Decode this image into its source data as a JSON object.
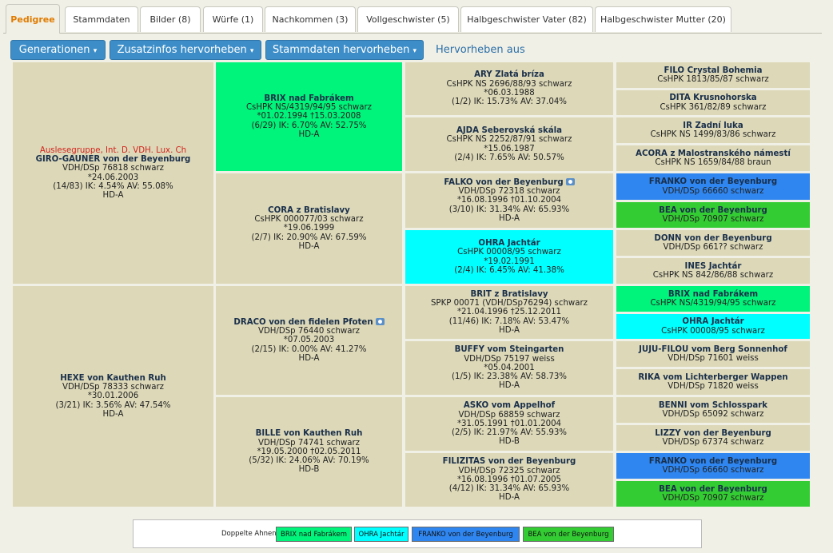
{
  "tabs": [
    "Pedigree",
    "Stammdaten",
    "Bilder (8)",
    "Würfe (1)",
    "Nachkommen (3)",
    "Vollgeschwister (5)",
    "Halbgeschwister Vater (82)",
    "Halbgeschwister Mutter (20)"
  ],
  "toolbar": {
    "generations": "Generationen",
    "extra": "Zusatzinfos hervorheben",
    "master": "Stammdaten hervorheben",
    "off": "Hervorheben aus",
    "caret": "▾"
  },
  "colors": {
    "cell": "#dcd8b8",
    "brix": "#00f37a",
    "ohra": "#00ffff",
    "franko": "#2f86f0",
    "bea": "#33cc33"
  },
  "pedigree": {
    "g1": [
      {
        "extra": "Auslesegruppe, Int. D. VDH. Lux. Ch",
        "name": "GIRO-GAUNER von der Beyenburg",
        "lines": [
          "VDH/DSp 76818 schwarz",
          "*24.06.2003",
          "(14/83) IK: 4.54% AV: 55.08%",
          "HD-A"
        ]
      },
      {
        "name": "HEXE von Kauthen Ruh",
        "lines": [
          "VDH/DSp 78333 schwarz",
          "*30.01.2006",
          "(3/21) IK: 3.56% AV: 47.54%",
          "HD-A"
        ]
      }
    ],
    "g2": [
      {
        "name": "BRIX nad Fabrákem",
        "lines": [
          "CsHPK NS/4319/94/95 schwarz",
          "*01.02.1994 †15.03.2008",
          "(6/29) IK: 6.70% AV: 52.75%",
          "HD-A"
        ]
      },
      {
        "name": "CORA z Bratislavy",
        "lines": [
          "CsHPK 000077/03 schwarz",
          "*19.06.1999",
          "(2/7) IK: 20.90% AV: 67.59%",
          "HD-A"
        ]
      },
      {
        "name": "DRACO von den fidelen Pfoten",
        "lines": [
          "VDH/DSp 76440 schwarz",
          "*07.05.2003",
          "(2/15) IK: 0.00% AV: 41.27%",
          "HD-A"
        ]
      },
      {
        "name": "BILLE von Kauthen Ruh",
        "lines": [
          "VDH/DSp 74741 schwarz",
          "*19.05.2000 †02.05.2011",
          "(5/32) IK: 24.06% AV: 70.19%",
          "HD-B"
        ]
      }
    ],
    "g3": [
      {
        "name": "ARY Zlatá bríza",
        "lines": [
          "CsHPK NS 2696/88/93 schwarz",
          "*06.03.1988",
          "(1/2) IK: 15.73% AV: 37.04%"
        ]
      },
      {
        "name": "AJDA Seberovská skála",
        "lines": [
          "CsHPK NS 2252/87/91 schwarz",
          "*15.06.1987",
          "(2/4) IK: 7.65% AV: 50.57%"
        ]
      },
      {
        "name": "FALKO von der Beyenburg",
        "lines": [
          "VDH/DSp 72318 schwarz",
          "*16.08.1996 †01.10.2004",
          "(3/10) IK: 31.34% AV: 65.93%",
          "HD-A"
        ]
      },
      {
        "name": "OHRA Jachtár",
        "lines": [
          "CsHPK 00008/95 schwarz",
          "*19.02.1991",
          "(2/4) IK: 6.45% AV: 41.38%"
        ]
      },
      {
        "name": "BRIT z Bratislavy",
        "lines": [
          "SPKP 00071 (VDH/DSp76294) schwarz",
          "*21.04.1996 †25.12.2011",
          "(11/46) IK: 7.18% AV: 53.47%",
          "HD-A"
        ]
      },
      {
        "name": "BUFFY vom Steingarten",
        "lines": [
          "VDH/DSp 75197 weiss",
          "*05.04.2001",
          "(1/5) IK: 23.38% AV: 58.73%",
          "HD-A"
        ]
      },
      {
        "name": "ASKO vom Appelhof",
        "lines": [
          "VDH/DSp 68859 schwarz",
          "*31.05.1991 †01.01.2004",
          "(2/5) IK: 21.97% AV: 55.93%",
          "HD-B"
        ]
      },
      {
        "name": "FILIZITAS von der Beyenburg",
        "lines": [
          "VDH/DSp 72325 schwarz",
          "*16.08.1996 †01.07.2005",
          "(4/12) IK: 31.34% AV: 65.93%",
          "HD-A"
        ]
      }
    ],
    "g4": [
      {
        "name": "FILO Crystal Bohemia",
        "line": "CsHPK 1813/85/87 schwarz"
      },
      {
        "name": "DITA Krusnohorska",
        "line": "CsHPK 361/82/89 schwarz"
      },
      {
        "name": "IR Zadní luka",
        "line": "CsHPK NS 1499/83/86 schwarz"
      },
      {
        "name": "ACORA z Malostranského námestí",
        "line": "CsHPK NS 1659/84/88 braun"
      },
      {
        "name": "FRANKO von der Beyenburg",
        "line": "VDH/DSp 66660 schwarz"
      },
      {
        "name": "BEA von der Beyenburg",
        "line": "VDH/DSp 70907 schwarz"
      },
      {
        "name": "DONN von der Beyenburg",
        "line": "VDH/DSp 661?? schwarz"
      },
      {
        "name": "INES Jachtár",
        "line": "CsHPK NS 842/86/88 schwarz"
      },
      {
        "name": "BRIX nad Fabrákem",
        "line": "CsHPK NS/4319/94/95 schwarz"
      },
      {
        "name": "OHRA Jachtár",
        "line": "CsHPK 00008/95 schwarz"
      },
      {
        "name": "JUJU-FILOU vom Berg Sonnenhof",
        "line": "VDH/DSp 71601 weiss"
      },
      {
        "name": "RIKA vom Lichterberger Wappen",
        "line": "VDH/DSp 71820 weiss"
      },
      {
        "name": "BENNI vom Schlosspark",
        "line": "VDH/DSp 65092 schwarz"
      },
      {
        "name": "LIZZY von der Beyenburg",
        "line": "VDH/DSp 67374 schwarz"
      },
      {
        "name": "FRANKO von der Beyenburg",
        "line": "VDH/DSp 66660 schwarz"
      },
      {
        "name": "BEA von der Beyenburg",
        "line": "VDH/DSp 70907 schwarz"
      }
    ]
  },
  "legend": {
    "label": "Doppelte Ahnen",
    "items": [
      "BRIX nad Fabrákem",
      "OHRA Jachtár",
      "FRANKO von der Beyenburg",
      "BEA von der Beyenburg"
    ]
  }
}
